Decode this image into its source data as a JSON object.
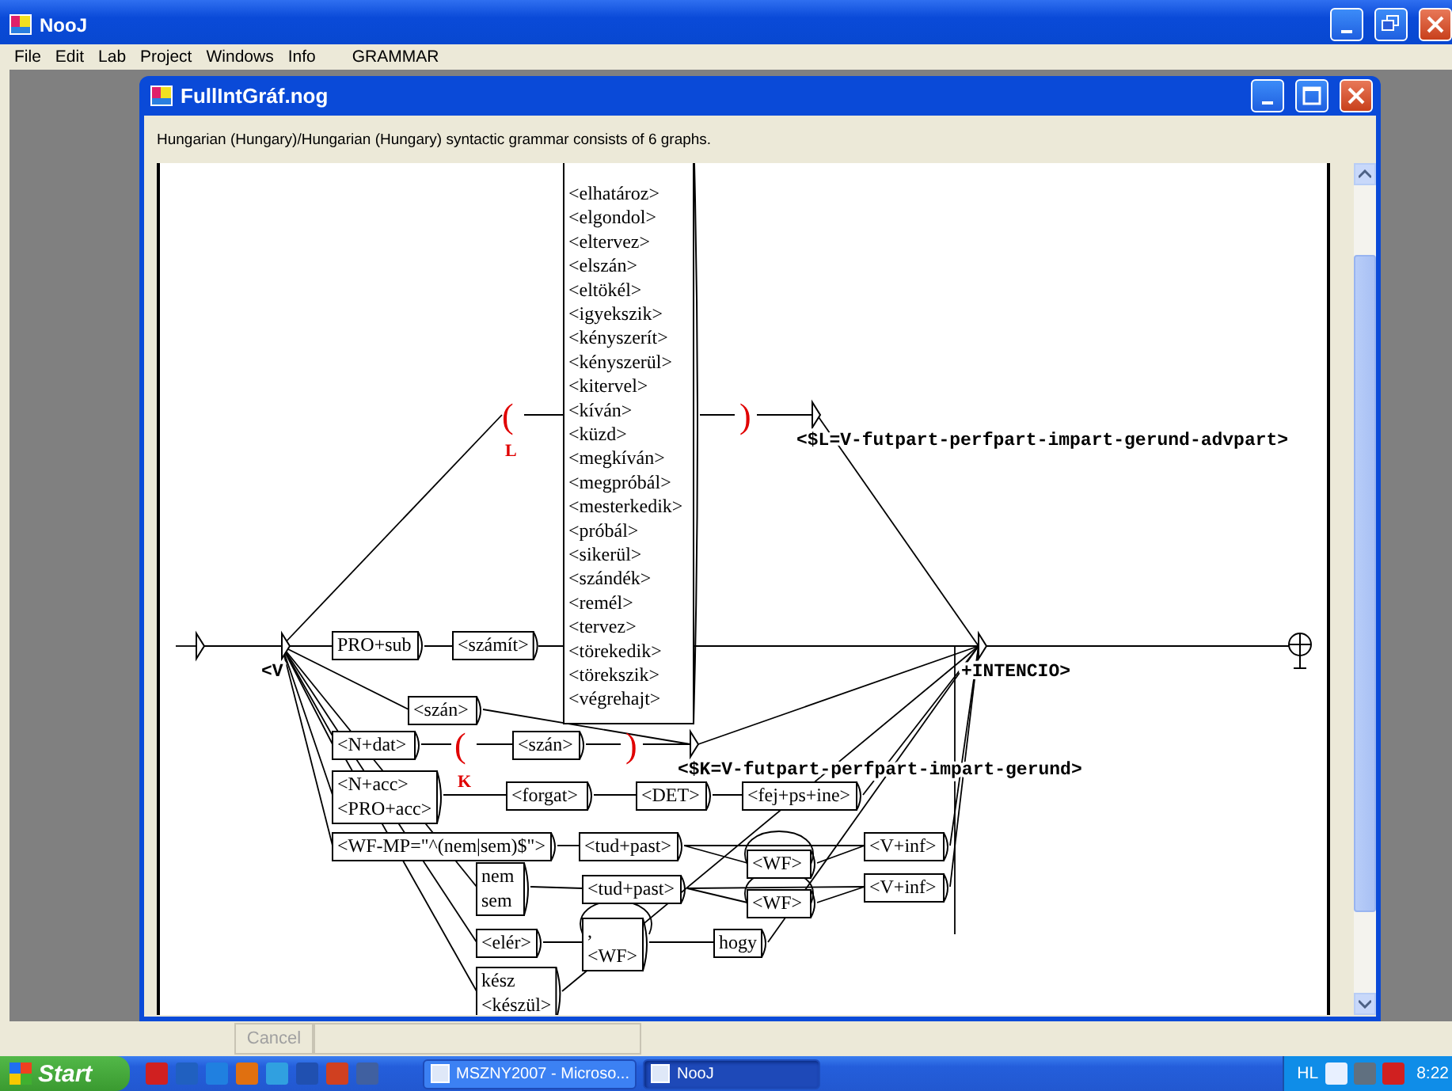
{
  "app": {
    "title": "NooJ",
    "menu": [
      "File",
      "Edit",
      "Lab",
      "Project",
      "Windows",
      "Info",
      "GRAMMAR"
    ]
  },
  "document": {
    "title": "FullIntGráf.nog",
    "info": "Hungarian (Hungary)/Hungarian (Hungary) syntactic grammar consists of 6 graphs.",
    "graph": {
      "nodes": [
        {
          "kind": "initial"
        },
        {
          "kind": "join",
          "output": "<V"
        },
        {
          "kind": "box",
          "lines": [
            "PRO+sub"
          ]
        },
        {
          "kind": "box",
          "lines": [
            "<számít>"
          ]
        },
        {
          "kind": "paren",
          "text": "(",
          "label": "L"
        },
        {
          "kind": "box",
          "lines": [
            "<elhatároz>",
            "<elgondol>",
            "<eltervez>",
            "<elszán>",
            "<eltökél>",
            "<igyekszik>",
            "<kényszerít>",
            "<kényszerül>",
            "<kitervel>",
            "<kíván>",
            "<küzd>",
            "<megkíván>",
            "<megpróbál>",
            "<mesterkedik>",
            "<próbál>",
            "<sikerül>",
            "<szándék>",
            "<remél>",
            "<tervez>",
            "<törekedik>",
            "<törekszik>",
            "<végrehajt>"
          ]
        },
        {
          "kind": "paren",
          "text": ")"
        },
        {
          "kind": "join",
          "output": "<$L=V-futpart-perfpart-impart-gerund-advpart>"
        },
        {
          "kind": "join",
          "output": "+INTENCIO>"
        },
        {
          "kind": "final"
        },
        {
          "kind": "box",
          "lines": [
            "<szán>"
          ]
        },
        {
          "kind": "box",
          "lines": [
            "<N+dat>"
          ]
        },
        {
          "kind": "paren",
          "text": "(",
          "label": "K"
        },
        {
          "kind": "box",
          "lines": [
            "<szán>"
          ]
        },
        {
          "kind": "paren",
          "text": ")"
        },
        {
          "kind": "join",
          "output": "<$K=V-futpart-perfpart-impart-gerund>"
        },
        {
          "kind": "box",
          "lines": [
            "<N+acc>",
            "<PRO+acc>"
          ]
        },
        {
          "kind": "box",
          "lines": [
            "<forgat>"
          ]
        },
        {
          "kind": "box",
          "lines": [
            "<DET>"
          ]
        },
        {
          "kind": "box",
          "lines": [
            "<fej+ps+ine>"
          ]
        },
        {
          "kind": "box",
          "lines": [
            "<WF-MP=\"^(nem|sem)$\">"
          ]
        },
        {
          "kind": "box",
          "lines": [
            "<tud+past>"
          ]
        },
        {
          "kind": "box",
          "lines": [
            "<WF>"
          ]
        },
        {
          "kind": "box",
          "lines": [
            "<V+inf>"
          ]
        },
        {
          "kind": "box",
          "lines": [
            "nem",
            "sem"
          ]
        },
        {
          "kind": "box",
          "lines": [
            "<tud+past>"
          ]
        },
        {
          "kind": "box",
          "lines": [
            "<WF>"
          ]
        },
        {
          "kind": "box",
          "lines": [
            "<V+inf>"
          ]
        },
        {
          "kind": "box",
          "lines": [
            "<elér>"
          ]
        },
        {
          "kind": "box",
          "lines": [
            ",",
            "<WF>"
          ]
        },
        {
          "kind": "box",
          "lines": [
            "hogy"
          ]
        },
        {
          "kind": "box",
          "lines": [
            "kész",
            "<készül>"
          ]
        }
      ]
    }
  },
  "footer": {
    "cancel": {
      "label": "Cancel",
      "disabled": true
    }
  },
  "taskbar": {
    "start": "Start",
    "tasks": [
      {
        "label": "MSZNY2007 - Microso...",
        "selected": false
      },
      {
        "label": "NooJ",
        "selected": true
      }
    ],
    "language": "HL",
    "clock": "8:22"
  }
}
